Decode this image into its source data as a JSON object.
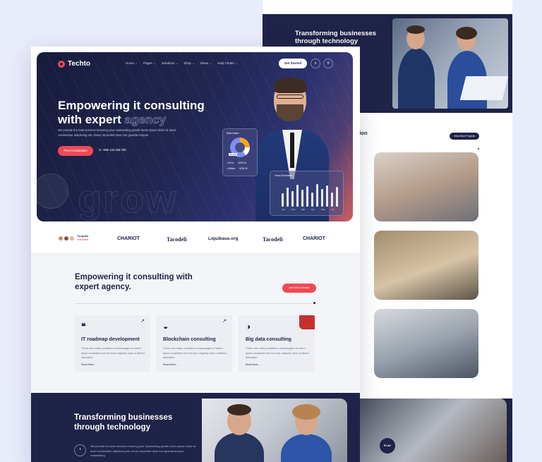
{
  "back_page": {
    "hero_title": "Transforming businesses through technology",
    "middle_title_fragment": "n ation",
    "view_projects_label": "View More Projects",
    "play_label": "PLAY"
  },
  "hero": {
    "logo": "Techto",
    "nav": [
      "Home ⌄",
      "Pages ⌄",
      "Solutions ⌄",
      "Shop ⌄",
      "News ⌄",
      "Help Center ⌄"
    ],
    "get_started_label": "Get Started",
    "title_line1": "Empowering it consulting",
    "title_line2": "with expert",
    "title_accent": "agency",
    "description": "We provide the best services ensuring your outstanding growth lorem ipsum dolor sit amet consectetur adipiscing elit. donec imperdiet risus non gravida tempus",
    "consultation_label": "Free Consultation",
    "phone": "+990 123 456 789",
    "watermark": "grow",
    "total_sales": {
      "title": "Total Sales",
      "badge": "25,448",
      "legend": [
        {
          "label": "• Direct",
          "value": "$285.56"
        },
        {
          "label": "• Affiliate",
          "value": "$285.56"
        }
      ]
    },
    "growth_card": {
      "title": "Grow Business",
      "months": [
        "Jan",
        "Feb",
        "Mar",
        "Apr",
        "May",
        "Jun"
      ],
      "values": [
        0.55,
        0.8,
        0.65,
        0.9,
        0.7,
        0.85,
        0.6,
        0.95,
        0.75,
        0.88,
        0.6,
        0.82
      ]
    }
  },
  "brands": {
    "trustpilot_label": "Trustpilot",
    "stars": "★★★★★",
    "items": [
      "CHARIOT",
      "Tacodeli",
      "Liquibase.org",
      "Tacodeli",
      "CHARIOT"
    ]
  },
  "services": {
    "title": "Empowering it consulting with expert agency.",
    "details_label": "See More Details",
    "cards": [
      {
        "title": "IT roadmap development",
        "desc": "There are many variations of passages of lorem ipsum available but the look majority have suffered alteration.",
        "more": "Read More →"
      },
      {
        "title": "Blockchain consulting",
        "desc": "There are many variations of passages of lorem ipsum available but the look majority have suffered alteration.",
        "more": "Read More →"
      },
      {
        "title": "Big data consulting",
        "desc": "There are many variations of passages of lorem ipsum available but the look majority have suffered alteration.",
        "more": "Read More →"
      }
    ]
  },
  "transform": {
    "title": "Transforming businesses through technology",
    "description": "We provide the best services ensuring your outstanding growth lorem ipsum dolor sit amet consectetur adipiscing elit. donec imperdiet risus non gravida tempus outstanding"
  },
  "colors": {
    "navy": "#1e2347",
    "accent_red": "#ef4a55",
    "page_bg": "#e9ecfb"
  }
}
